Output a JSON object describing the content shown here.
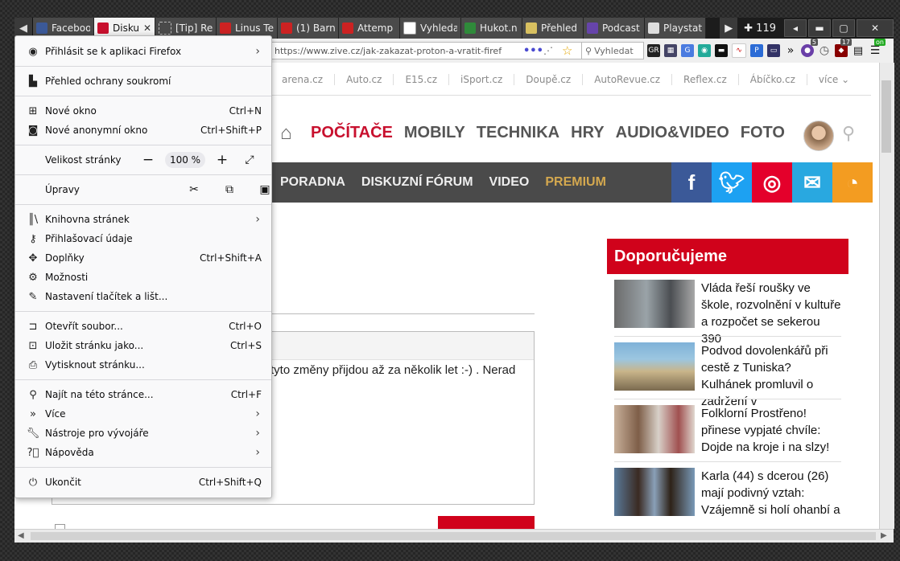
{
  "tabs": [
    {
      "label": "Facebook",
      "color": "#3b5998",
      "active": false
    },
    {
      "label": "Disku",
      "color": "#c8102e",
      "active": true
    },
    {
      "label": "[Tip] Re",
      "color": "#888888",
      "active": false
    },
    {
      "label": "Linus Te",
      "color": "#cc2222",
      "active": false
    },
    {
      "label": "(1) Barn",
      "color": "#cc2222",
      "active": false
    },
    {
      "label": "Attemp",
      "color": "#cc2222",
      "active": false
    },
    {
      "label": "Vyhleda",
      "color": "#ffffff",
      "active": false
    },
    {
      "label": "Hukot.n",
      "color": "#2f8a3a",
      "active": false
    },
    {
      "label": "Přehled",
      "color": "#d8c060",
      "active": false
    },
    {
      "label": "Podcast",
      "color": "#6644aa",
      "active": false
    },
    {
      "label": "Playstat",
      "color": "#dddddd",
      "active": false
    }
  ],
  "tab_count": "119",
  "url": "https://www.zive.cz/jak-zakazat-proton-a-vratit-firef",
  "search_placeholder": "Vyhledat",
  "ext_badges": {
    "first": "5",
    "second": "17",
    "third": "on"
  },
  "page": {
    "toplinks": [
      "arena.cz",
      "Auto.cz",
      "E15.cz",
      "iSport.cz",
      "Doupě.cz",
      "AutoRevue.cz",
      "Reflex.cz",
      "Ábíčko.cz",
      "více ⌄"
    ],
    "mainnav": [
      "POČÍTAČE",
      "MOBILY",
      "TECHNIKA",
      "HRY",
      "AUDIO&VIDEO",
      "FOTO"
    ],
    "subnav": [
      "PORADNA",
      "DISKUZNÍ FÓRUM",
      "VIDEO",
      "PREMIUM"
    ],
    "social": [
      {
        "glyph": "f",
        "color": "#3b5998"
      },
      {
        "glyph": "t",
        "color": "#1da1f2"
      },
      {
        "glyph": "◎",
        "color": "#e4002b"
      },
      {
        "glyph": "✉",
        "color": "#29a8e0"
      },
      {
        "glyph": "◔",
        "color": "#f39c21"
      }
    ],
    "recommended_title": "Doporučujeme",
    "recommended": [
      {
        "text": "Vláda řeší roušky ve škole, rozvolnění v kultuře a rozpočet se sekerou 390"
      },
      {
        "text": "Podvod dovolenkářů při cestě z Tuniska? Kulhánek promluvil o zadržení v"
      },
      {
        "text": "Folklorní Prostřeno! přinese vypjaté chvíle: Dojde na kroje i na slzy!"
      },
      {
        "text": "Karla (44) s dcerou (26) mají podivný vztah: Vzájemně si holí ohanbí a"
      }
    ],
    "comment_text": "tyto změny přijdou až za několik let :-) . Nerad"
  },
  "menu": {
    "sign_in": "Přihlásit se k aplikaci Firefox",
    "privacy": "Přehled ochrany soukromí",
    "new_window": "Nové okno",
    "new_window_sc": "Ctrl+N",
    "private_window": "Nové anonymní okno",
    "private_window_sc": "Ctrl+Shift+P",
    "zoom_label": "Velikost stránky",
    "zoom_value": "100 %",
    "edit_label": "Úpravy",
    "library": "Knihovna stránek",
    "logins": "Přihlašovací údaje",
    "addons": "Doplňky",
    "addons_sc": "Ctrl+Shift+A",
    "options": "Možnosti",
    "customize": "Nastavení tlačítek a lišt...",
    "open_file": "Otevřít soubor...",
    "open_file_sc": "Ctrl+O",
    "save_page": "Uložit stránku jako...",
    "save_page_sc": "Ctrl+S",
    "print": "Vytisknout stránku...",
    "find": "Najít na této stránce...",
    "find_sc": "Ctrl+F",
    "more": "Více",
    "devtools": "Nástroje pro vývojáře",
    "help": "Nápověda",
    "quit": "Ukončit",
    "quit_sc": "Ctrl+Shift+Q"
  }
}
